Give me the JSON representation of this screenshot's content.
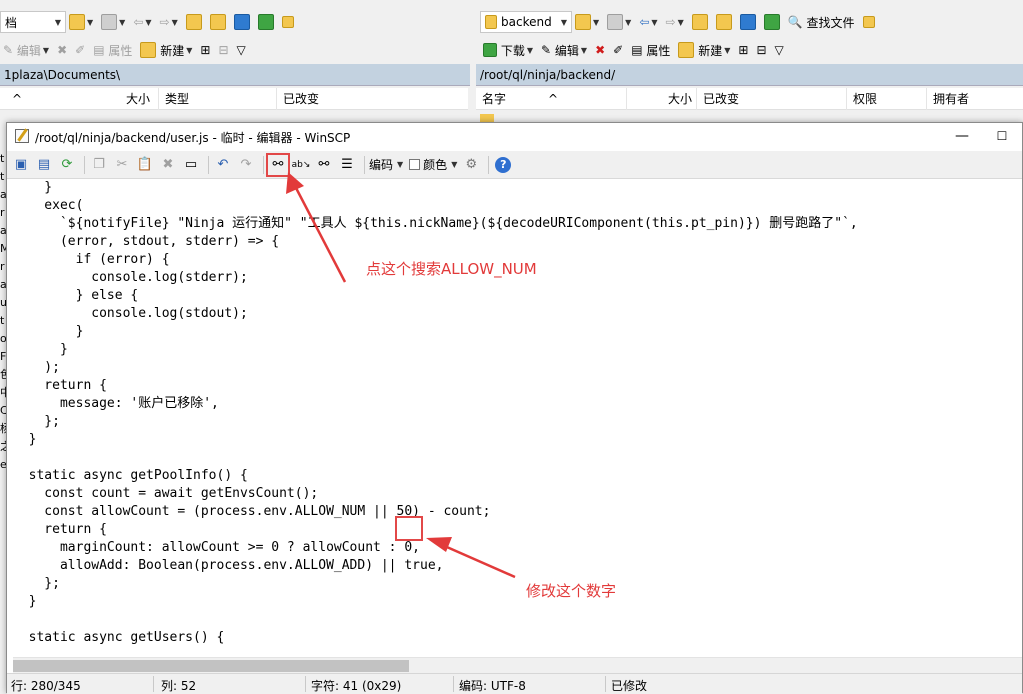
{
  "background": {
    "left_pane": {
      "drive_combo": "档",
      "toolbar2": {
        "edit": "编辑",
        "props": "属性",
        "new": "新建"
      },
      "path": "1plaza\\Documents\\",
      "columns": [
        "大小",
        "类型",
        "已改变"
      ],
      "left_strip_chars": [
        "t",
        "t",
        "a",
        "r",
        "a",
        "M",
        "r",
        "a",
        "ur",
        "t",
        "o",
        "F",
        "色",
        "中",
        "C",
        "杨",
        "之",
        "e"
      ]
    },
    "right_pane": {
      "folder_combo": "backend",
      "find_files": "查找文件",
      "toolbar2": {
        "download": "下载",
        "edit": "编辑",
        "props": "属性",
        "new": "新建"
      },
      "path": "/root/ql/ninja/backend/",
      "columns": [
        "名字",
        "大小",
        "已改变",
        "权限",
        "拥有者"
      ]
    }
  },
  "editor": {
    "title": "/root/ql/ninja/backend/user.js - 临时 - 编辑器 - WinSCP",
    "toolbar": {
      "encoding": "编码",
      "color": "颜色"
    },
    "code_lines": [
      "    }",
      "    exec(",
      "      `${notifyFile} \"Ninja 运行通知\" \"工具人 ${this.nickName}(${decodeURIComponent(this.pt_pin)}) 删号跑路了\"`,",
      "      (error, stdout, stderr) => {",
      "        if (error) {",
      "          console.log(stderr);",
      "        } else {",
      "          console.log(stdout);",
      "        }",
      "      }",
      "    );",
      "    return {",
      "      message: '账户已移除',",
      "    };",
      "  }",
      "",
      "  static async getPoolInfo() {",
      "    const count = await getEnvsCount();",
      "    const allowCount = (process.env.ALLOW_NUM || 50) - count;",
      "    return {",
      "      marginCount: allowCount >= 0 ? allowCount : 0,",
      "      allowAdd: Boolean(process.env.ALLOW_ADD) || true,",
      "    };",
      "  }",
      "",
      "  static async getUsers() {"
    ],
    "status": {
      "line": "行: 280/345",
      "col": "列: 52",
      "char": "字符: 41 (0x29)",
      "encoding": "编码: UTF-8",
      "modified": "已修改"
    }
  },
  "annotations": {
    "search_hint": "点这个搜索ALLOW_NUM",
    "edit_hint": "修改这个数字",
    "color": "#e23a3a"
  }
}
